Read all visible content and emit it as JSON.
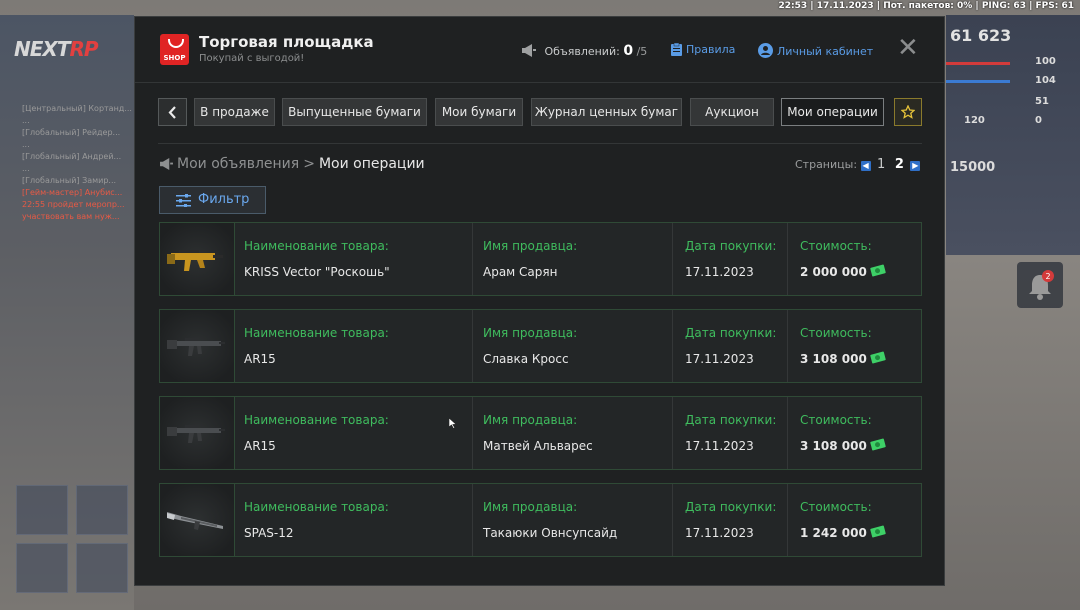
{
  "status_bar": "22:53 | 17.11.2023 | Пот. пакетов: 0% | PING: 63 | FPS: 61",
  "hud": {
    "logo_main": "NEXT",
    "logo_accent": "RP",
    "money": "61 623",
    "stats": [
      "100",
      "104",
      "51",
      "0"
    ],
    "stat_120": "120",
    "balance": "15000",
    "notif_count": "2"
  },
  "window": {
    "title": "Торговая площадка",
    "subtitle": "Покупай с выгодой!",
    "logo_label": "SHOP",
    "ads_label": "Объявлений:",
    "ads_count": "0",
    "ads_max": "/5",
    "rules_label": "Правила",
    "cabinet_label": "Личный кабинет",
    "close_label": "✕"
  },
  "tabs": [
    {
      "label": "В продаже"
    },
    {
      "label": "Выпущенные бумаги"
    },
    {
      "label": "Мои бумаги"
    },
    {
      "label": "Журнал ценных бумаг"
    },
    {
      "label": "Аукцион"
    },
    {
      "label": "Мои операции"
    }
  ],
  "breadcrumb": {
    "parent": "Мои объявления",
    "separator": ">",
    "current": "Мои операции"
  },
  "pagination": {
    "label": "Страницы:",
    "pages": [
      "1",
      "2"
    ],
    "current": "2"
  },
  "filter_label": "Фильтр",
  "columns": {
    "item": "Наименование товара:",
    "seller": "Имя продавца:",
    "date": "Дата покупки:",
    "price": "Стоимость:"
  },
  "rows": [
    {
      "item": "KRISS Vector \"Роскошь\"",
      "seller": "Арам Сарян",
      "date": "17.11.2023",
      "price": "2 000 000",
      "icon": "kriss-vector-gold-icon"
    },
    {
      "item": "AR15",
      "seller": "Славка Кросс",
      "date": "17.11.2023",
      "price": "3 108 000",
      "icon": "ar15-rifle-icon"
    },
    {
      "item": "AR15",
      "seller": "Матвей Альварес",
      "date": "17.11.2023",
      "price": "3 108 000",
      "icon": "ar15-rifle-icon"
    },
    {
      "item": "SPAS-12",
      "seller": "Такаюки Овнсупсайд",
      "date": "17.11.2023",
      "price": "1 242 000",
      "icon": "spas12-shotgun-icon"
    }
  ],
  "colors": {
    "accent_blue": "#5a9ce6",
    "label_green": "#3fbc5e",
    "row_border": "#2f4a36",
    "logo_red": "#e02424",
    "star_gold": "#e7c43a"
  }
}
